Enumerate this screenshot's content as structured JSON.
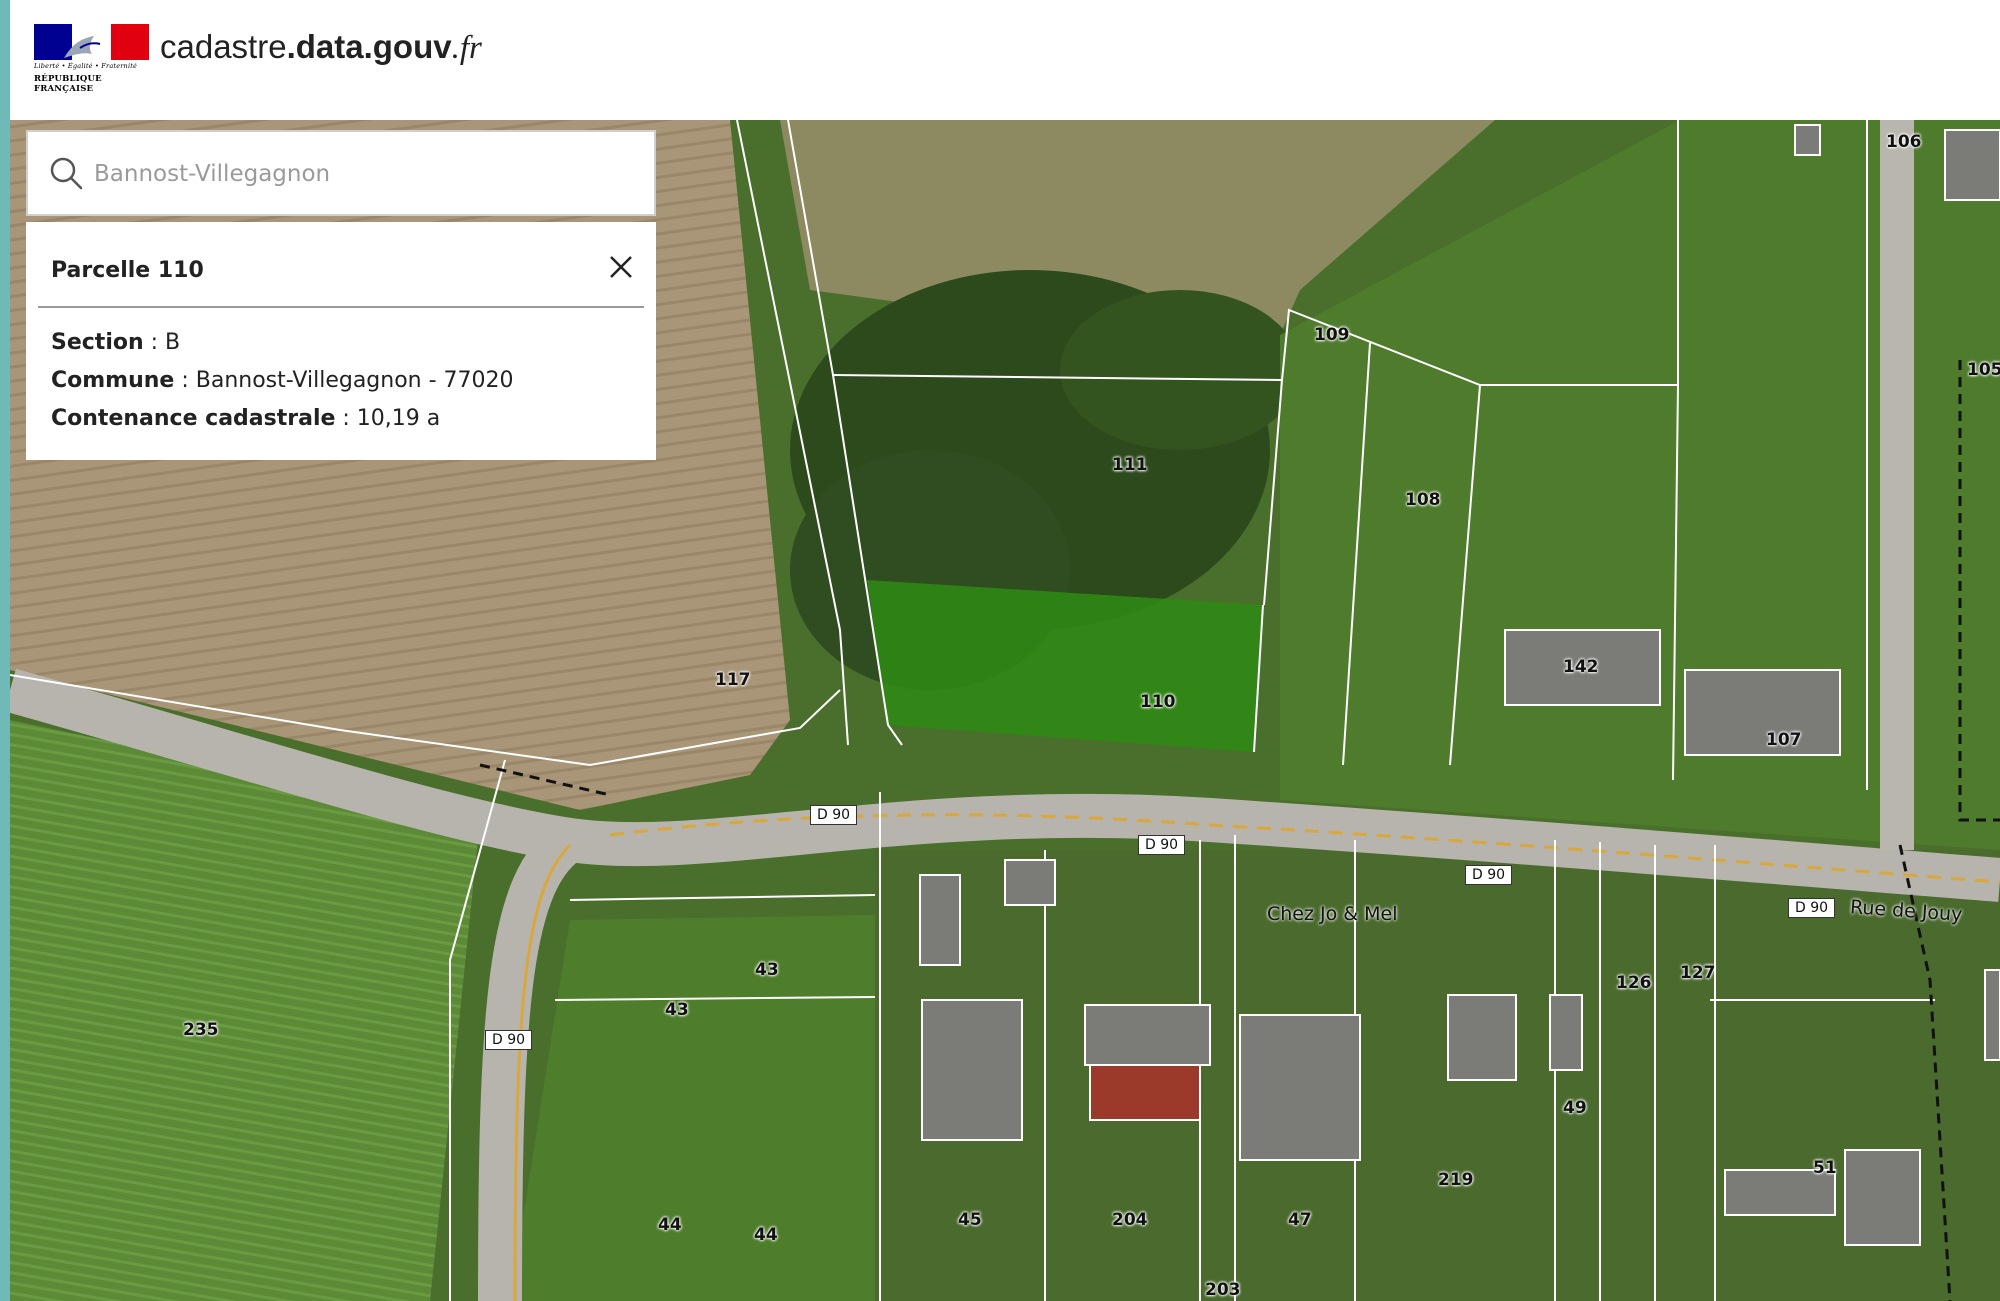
{
  "header": {
    "site_title_prefix": "cadastre",
    "site_title_bold": ".data.gouv",
    "site_title_suffix": ".fr",
    "logo_motto": "Liberté • Égalité • Fraternité",
    "logo_republic": "RÉPUBLIQUE FRANÇAISE"
  },
  "search": {
    "value": "",
    "placeholder": "Bannost-Villegagnon"
  },
  "parcel_panel": {
    "title": "Parcelle 110",
    "section_label": "Section",
    "section_value": " : B",
    "commune_label": "Commune",
    "commune_value": " : Bannost-Villegagnon - 77020",
    "contenance_label": "Contenance cadastrale",
    "contenance_value": " : 10,19 a"
  },
  "map": {
    "parcel_labels": [
      "106",
      "109",
      "111",
      "108",
      "105",
      "117",
      "110",
      "142",
      "107",
      "43",
      "43",
      "235",
      "126",
      "127",
      "49",
      "219",
      "51",
      "44",
      "44",
      "45",
      "204",
      "47",
      "203"
    ],
    "road_labels": [
      "D 90",
      "D 90",
      "D 90",
      "D 90",
      "D 90"
    ],
    "place_names": [
      "Chez Jo & Mel",
      "Rue de Jouy"
    ],
    "selected_parcel_color": "#2e8b14"
  }
}
